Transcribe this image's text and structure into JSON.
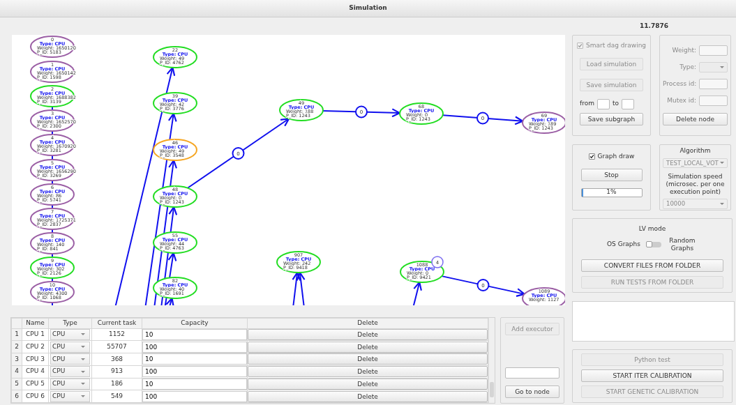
{
  "window": {
    "title": "Simulation"
  },
  "graph": {
    "nodes": [
      {
        "id": "0",
        "type": "Type: CPU",
        "weight": "Weight: 1650120",
        "pid": "P_ID: 5183",
        "color": "#9b5fa5"
      },
      {
        "id": "1",
        "type": "Type: CPU",
        "weight": "Weight: 1650142",
        "pid": "P_ID: 1598",
        "color": "#9b5fa5"
      },
      {
        "id": "2",
        "type": "Type: CPU",
        "weight": "Weight: 1688382",
        "pid": "P_ID: 3139",
        "color": "#22dd22"
      },
      {
        "id": "3",
        "type": "Type: CPU",
        "weight": "Weight: 1652570",
        "pid": "P_ID: 2300",
        "color": "#9b5fa5"
      },
      {
        "id": "4",
        "type": "Type: CPU",
        "weight": "Weight: 1670920",
        "pid": "P_ID: 3281",
        "color": "#9b5fa5"
      },
      {
        "id": "5",
        "type": "Type: CPU",
        "weight": "Weight: 1656290",
        "pid": "P_ID: 3269",
        "color": "#9b5fa5"
      },
      {
        "id": "6",
        "type": "Type: CPU",
        "weight": "Weight: 86",
        "pid": "P_ID: 5741",
        "color": "#9b5fa5"
      },
      {
        "id": "7",
        "type": "Type: CPU",
        "weight": "Weight: 1725371",
        "pid": "P_ID: 2837",
        "color": "#9b5fa5"
      },
      {
        "id": "8",
        "type": "Type: CPU",
        "weight": "Weight: 140",
        "pid": "P_ID: 841",
        "color": "#9b5fa5"
      },
      {
        "id": "9",
        "type": "Type: CPU",
        "weight": "Weight: 302",
        "pid": "P_ID: 2126",
        "color": "#22dd22"
      },
      {
        "id": "10",
        "type": "Type: CPU",
        "weight": "Weight: 4300",
        "pid": "P_ID: 1068",
        "color": "#9b5fa5"
      },
      {
        "id": "22",
        "type": "Type: CPU",
        "weight": "Weight: 49",
        "pid": "P_ID: 4762",
        "color": "#22dd22"
      },
      {
        "id": "39",
        "type": "Type: CPU",
        "weight": "Weight: 42",
        "pid": "P_ID: 3776",
        "color": "#22dd22"
      },
      {
        "id": "46",
        "type": "Type: CPU",
        "weight": "Weight: 49",
        "pid": "P_ID: 3548",
        "color": "#f5a623"
      },
      {
        "id": "48",
        "type": "Type: CPU",
        "weight": "Weight: 0",
        "pid": "P_ID: 1243",
        "color": "#22dd22"
      },
      {
        "id": "55",
        "type": "Type: CPU",
        "weight": "Weight: 44",
        "pid": "P_ID: 4763",
        "color": "#22dd22"
      },
      {
        "id": "82",
        "type": "Type: CPU",
        "weight": "Weight: 40",
        "pid": "P_ID: 1691",
        "color": "#22dd22"
      },
      {
        "id": "49",
        "type": "Type: CPU",
        "weight": "Weight: 188",
        "pid": "P_ID: 1243",
        "color": "#22dd22"
      },
      {
        "id": "68",
        "type": "Type: CPU",
        "weight": "Weight: 0",
        "pid": "P_ID: 1243",
        "color": "#22dd22"
      },
      {
        "id": "69",
        "type": "Type: CPU",
        "weight": "Weight: 189",
        "pid": "P_ID: 1243",
        "color": "#9b5fa5"
      },
      {
        "id": "907",
        "type": "Type: CPU",
        "weight": "Weight: 242",
        "pid": "P_ID: 9418",
        "color": "#22dd22"
      },
      {
        "id": "1088",
        "type": "Type: CPU",
        "weight": "Weight: 0",
        "pid": "P_ID: 9421",
        "color": "#22dd22",
        "badge": "4"
      },
      {
        "id": "1089",
        "type": "Type: CPU",
        "weight": "Weight: 1127",
        "color": "#9b5fa5"
      }
    ],
    "edges": [
      {
        "label": "0"
      },
      {
        "label": "0"
      },
      {
        "label": "0"
      },
      {
        "label": "0"
      }
    ]
  },
  "executors": {
    "columns": [
      "Name",
      "Type",
      "Current task",
      "Capacity",
      "Delete"
    ],
    "rows": [
      {
        "number": "1",
        "name": "CPU 1",
        "type": "CPU",
        "current_task": "1152",
        "capacity": "10",
        "action": "Delete"
      },
      {
        "number": "2",
        "name": "CPU 2",
        "type": "CPU",
        "current_task": "55707",
        "capacity": "100",
        "action": "Delete"
      },
      {
        "number": "3",
        "name": "CPU 3",
        "type": "CPU",
        "current_task": "368",
        "capacity": "10",
        "action": "Delete"
      },
      {
        "number": "4",
        "name": "CPU 4",
        "type": "CPU",
        "current_task": "913",
        "capacity": "100",
        "action": "Delete"
      },
      {
        "number": "5",
        "name": "CPU 5",
        "type": "CPU",
        "current_task": "186",
        "capacity": "10",
        "action": "Delete"
      },
      {
        "number": "6",
        "name": "CPU 6",
        "type": "CPU",
        "current_task": "549",
        "capacity": "100",
        "action": "Delete"
      }
    ]
  },
  "executor_panel": {
    "add_button": {
      "label": "Add executor",
      "disabled": true
    },
    "goto_button": {
      "label": "Go to node",
      "disabled": false
    }
  },
  "timer": "11.7876",
  "file_panel": {
    "smart_dag": {
      "label": "Smart dag drawing",
      "checked": true,
      "disabled": true
    },
    "load_button": {
      "label": "Load simulation",
      "disabled": true
    },
    "save_button": {
      "label": "Save simulation",
      "disabled": true
    },
    "from_label": "from",
    "to_label": "to",
    "save_subgraph_button": {
      "label": "Save subgraph",
      "disabled": false
    }
  },
  "node_panel": {
    "fields": [
      {
        "label": "Weight:",
        "kind": "input",
        "disabled": true
      },
      {
        "label": "Type:",
        "kind": "select",
        "disabled": true
      },
      {
        "label": "Process id:",
        "kind": "input",
        "disabled": true
      },
      {
        "label": "Mutex id:",
        "kind": "input",
        "disabled": true
      }
    ],
    "delete_button": {
      "label": "Delete node",
      "disabled": false
    }
  },
  "draw_panel": {
    "graph_draw": {
      "label": "Graph draw",
      "checked": true
    },
    "stop_button": {
      "label": "Stop",
      "disabled": false
    },
    "progress": {
      "level": 0.01,
      "reading": "1%"
    }
  },
  "algorithm_panel": {
    "title": "Algorithm",
    "algorithm": {
      "value": "TEST_LOCAL_VOT",
      "disabled": true
    },
    "speed_label": "Simulation speed (microsec. per one execution point)",
    "speed": {
      "value": "10000",
      "disabled": true
    }
  },
  "lv_panel": {
    "title": "LV mode",
    "left_label": "OS Graphs",
    "switch": {
      "on": false
    },
    "right_label": "Random Graphs",
    "convert_button": {
      "label": "CONVERT FILES FROM FOLDER",
      "disabled": false
    },
    "run_button": {
      "label": "RUN TESTS FROM FOLDER",
      "disabled": true
    }
  },
  "calibration_panel": {
    "buttons": [
      {
        "label": "Python test",
        "disabled": true
      },
      {
        "label": "START ITER CALIBRATION",
        "disabled": false
      },
      {
        "label": "START GENETIC CALIBRATION",
        "disabled": true
      }
    ]
  }
}
